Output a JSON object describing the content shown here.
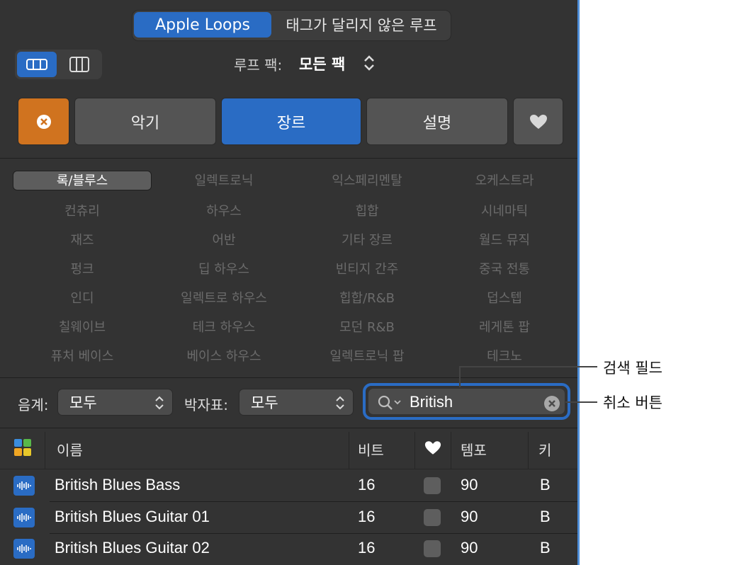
{
  "top_tabs": {
    "active": "Apple Loops",
    "inactive": "태그가 달리지 않은 루프"
  },
  "view_toggle": {
    "selected_icon": "button-view-icon",
    "other_icon": "column-view-icon"
  },
  "loop_pack": {
    "label": "루프 팩:",
    "value": "모든 팩"
  },
  "filter_buttons": {
    "reset_icon": "close-circle-icon",
    "instrument": "악기",
    "genre": "장르",
    "description": "설명",
    "favorites_icon": "heart-icon"
  },
  "genres": [
    "록/블루스",
    "일렉트로닉",
    "익스페리멘탈",
    "오케스트라",
    "컨츄리",
    "하우스",
    "힙합",
    "시네마틱",
    "재즈",
    "어반",
    "기타 장르",
    "월드 뮤직",
    "펑크",
    "딥 하우스",
    "빈티지 간주",
    "중국 전통",
    "인디",
    "일렉트로 하우스",
    "힙합/R&B",
    "덥스텝",
    "칠웨이브",
    "테크 하우스",
    "모던 R&B",
    "레게톤 팝",
    "퓨처 베이스",
    "베이스 하우스",
    "일렉트로닉 팝",
    "테크노"
  ],
  "selected_genre": "록/블루스",
  "scale": {
    "label": "음계:",
    "value": "모두"
  },
  "time_signature": {
    "label": "박자표:",
    "value": "모두"
  },
  "search": {
    "value": "British"
  },
  "table": {
    "headers": {
      "name": "이름",
      "beats": "비트",
      "tempo": "템포",
      "key": "키"
    },
    "rows": [
      {
        "name": "British Blues Bass",
        "beats": "16",
        "tempo": "90",
        "key": "B"
      },
      {
        "name": "British Blues Guitar 01",
        "beats": "16",
        "tempo": "90",
        "key": "B"
      },
      {
        "name": "British Blues Guitar 02",
        "beats": "16",
        "tempo": "90",
        "key": "B"
      }
    ]
  },
  "callouts": {
    "search_field": "검색 필드",
    "cancel_button": "취소 버튼"
  },
  "colors": {
    "accent": "#2a6cc4",
    "reset": "#d0731f",
    "panel": "#333333"
  }
}
